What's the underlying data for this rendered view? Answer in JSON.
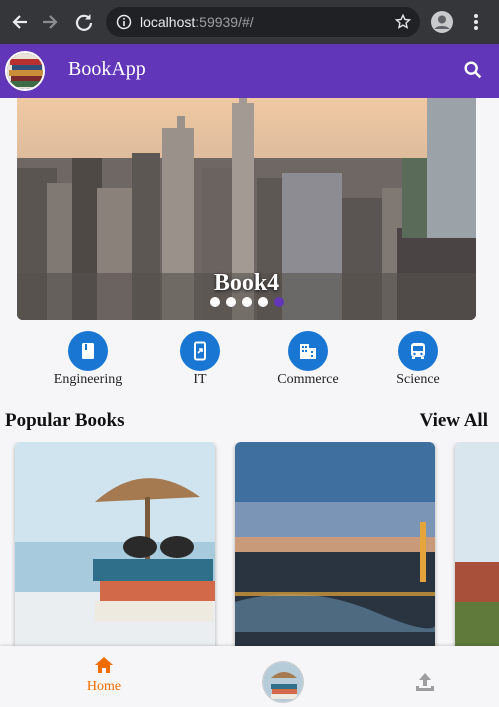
{
  "browser": {
    "url_host": "localhost",
    "url_rest": ":59939/#/"
  },
  "appbar": {
    "title": "BookApp"
  },
  "carousel": {
    "title": "Book4",
    "slide_count": 5,
    "active_index": 4
  },
  "categories": [
    {
      "label": "Engineering",
      "icon": "book-icon"
    },
    {
      "label": "IT",
      "icon": "mobile-link-icon"
    },
    {
      "label": "Commerce",
      "icon": "building-icon"
    },
    {
      "label": "Science",
      "icon": "bus-icon"
    }
  ],
  "popular": {
    "title": "Popular Books",
    "view_all": "View All"
  },
  "bottom_nav": {
    "home_label": "Home"
  },
  "colors": {
    "appbar": "#6236b8",
    "category_circle": "#1976d2",
    "active_tab": "#ef6c00",
    "browser_chrome": "#35363a"
  }
}
